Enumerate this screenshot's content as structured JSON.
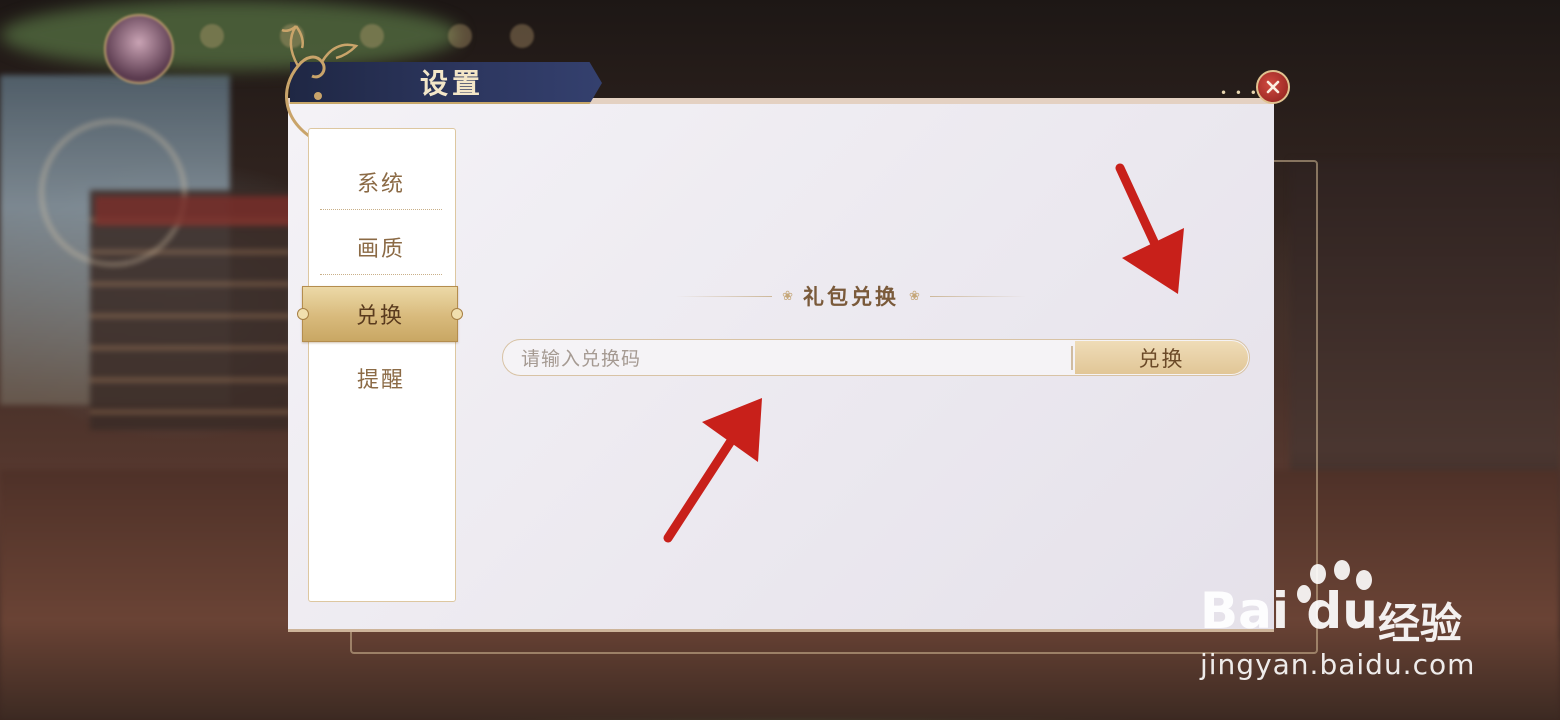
{
  "panel": {
    "title": "设置",
    "close_icon": "close-icon"
  },
  "tabs": [
    {
      "label": "系统",
      "active": false
    },
    {
      "label": "画质",
      "active": false
    },
    {
      "label": "兑换",
      "active": true
    },
    {
      "label": "提醒",
      "active": false
    }
  ],
  "redeem": {
    "heading": "礼包兑换",
    "placeholder": "请输入兑换码",
    "value": "",
    "button_label": "兑换"
  },
  "annotations": {
    "color": "#c8201a",
    "count": 2
  },
  "watermark": {
    "brand": "Bai du",
    "brand_suffix": "经验",
    "url": "jingyan.baidu.com"
  },
  "colors": {
    "accent_gold": "#d8ba7c",
    "title_navy": "#2d3760",
    "close_red": "#c8322b"
  }
}
